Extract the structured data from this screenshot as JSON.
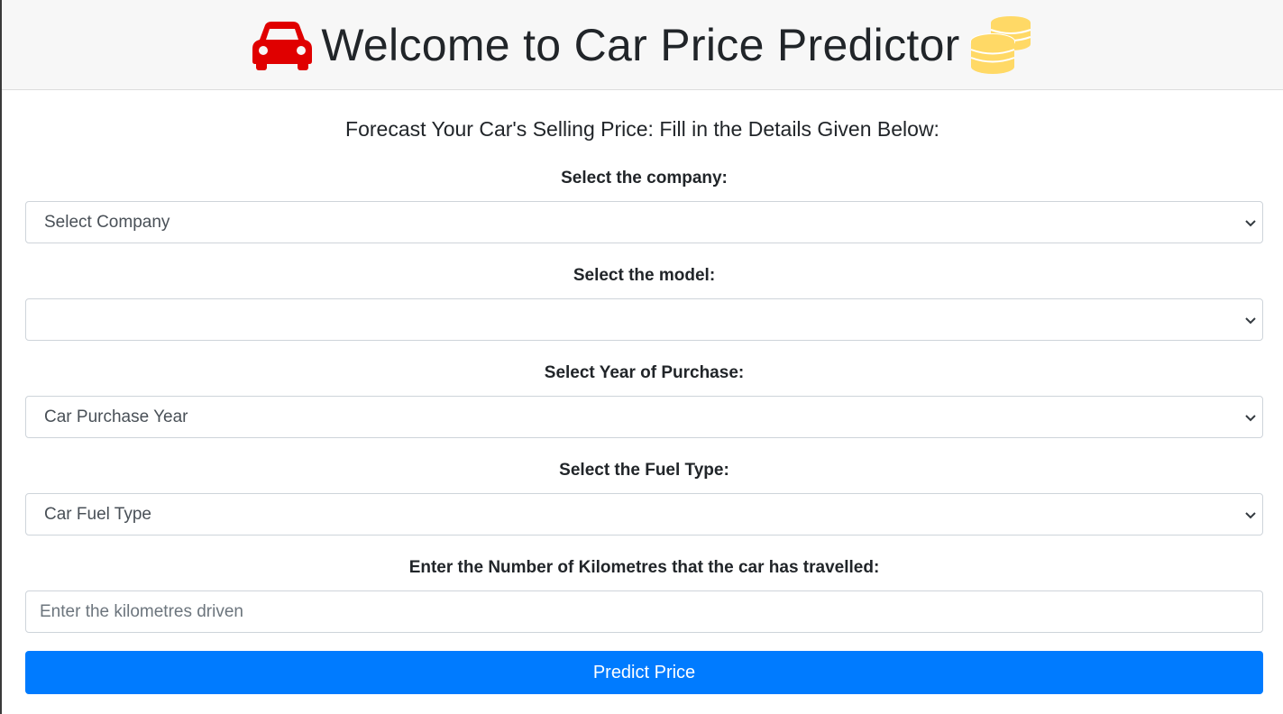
{
  "header": {
    "title": "Welcome to Car Price Predictor"
  },
  "subtitle": "Forecast Your Car's Selling Price: Fill in the Details Given Below:",
  "form": {
    "company": {
      "label": "Select the company:",
      "selected": "Select Company"
    },
    "model": {
      "label": "Select the model:",
      "selected": ""
    },
    "year": {
      "label": "Select Year of Purchase:",
      "selected": "Car Purchase Year"
    },
    "fuel": {
      "label": "Select the Fuel Type:",
      "selected": "Car Fuel Type"
    },
    "kms": {
      "label": "Enter the Number of Kilometres that the car has travelled:",
      "placeholder": "Enter the kilometres driven"
    },
    "submit_label": "Predict Price"
  },
  "colors": {
    "car_icon": "#e00000",
    "coins_icon": "#ffd966",
    "button": "#007bff"
  },
  "icons": {
    "title_left": "car-icon",
    "title_right": "coins-icon",
    "select_arrow": "chevron-down-icon"
  }
}
